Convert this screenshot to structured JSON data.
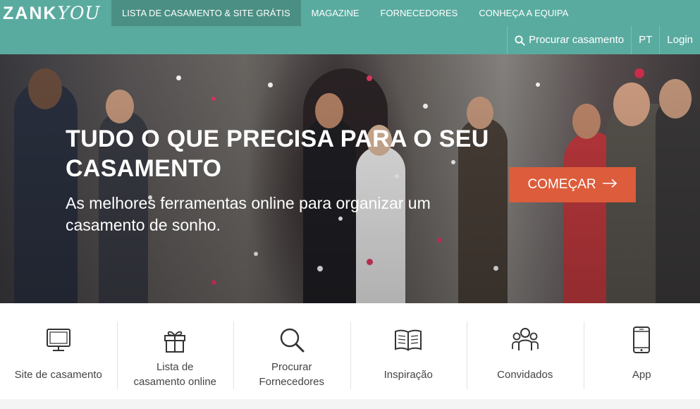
{
  "brand": {
    "logo_part1": "ZANK",
    "logo_part2": "YOU"
  },
  "nav": {
    "items": [
      {
        "label": "LISTA DE CASAMENTO & SITE GRÁTIS",
        "active": true
      },
      {
        "label": "MAGAZINE"
      },
      {
        "label": "FORNECEDORES"
      },
      {
        "label": "CONHEÇA A EQUIPA"
      }
    ]
  },
  "subnav": {
    "search_label": "Procurar casamento",
    "search_icon": "search-icon",
    "language": "PT",
    "login": "Login"
  },
  "hero": {
    "title": "TUDO O QUE PRECISA PARA O SEU CASAMENTO",
    "subtitle": "As melhores ferramentas online para organizar um casamento de sonho.",
    "cta_label": "COMEÇAR",
    "cta_icon": "arrow-right-icon"
  },
  "features": [
    {
      "label": "Site de casamento",
      "icon": "monitor-icon"
    },
    {
      "label": "Lista de casamento online",
      "icon": "gift-icon"
    },
    {
      "label": "Procurar Fornecedores",
      "icon": "search-icon"
    },
    {
      "label": "Inspiração",
      "icon": "book-icon"
    },
    {
      "label": "Convidados",
      "icon": "guests-icon"
    },
    {
      "label": "App",
      "icon": "phone-icon"
    }
  ],
  "colors": {
    "header": "#5aab9f",
    "nav_active": "#4b8f84",
    "cta": "#dc5c3b",
    "feature_text": "#444444"
  }
}
